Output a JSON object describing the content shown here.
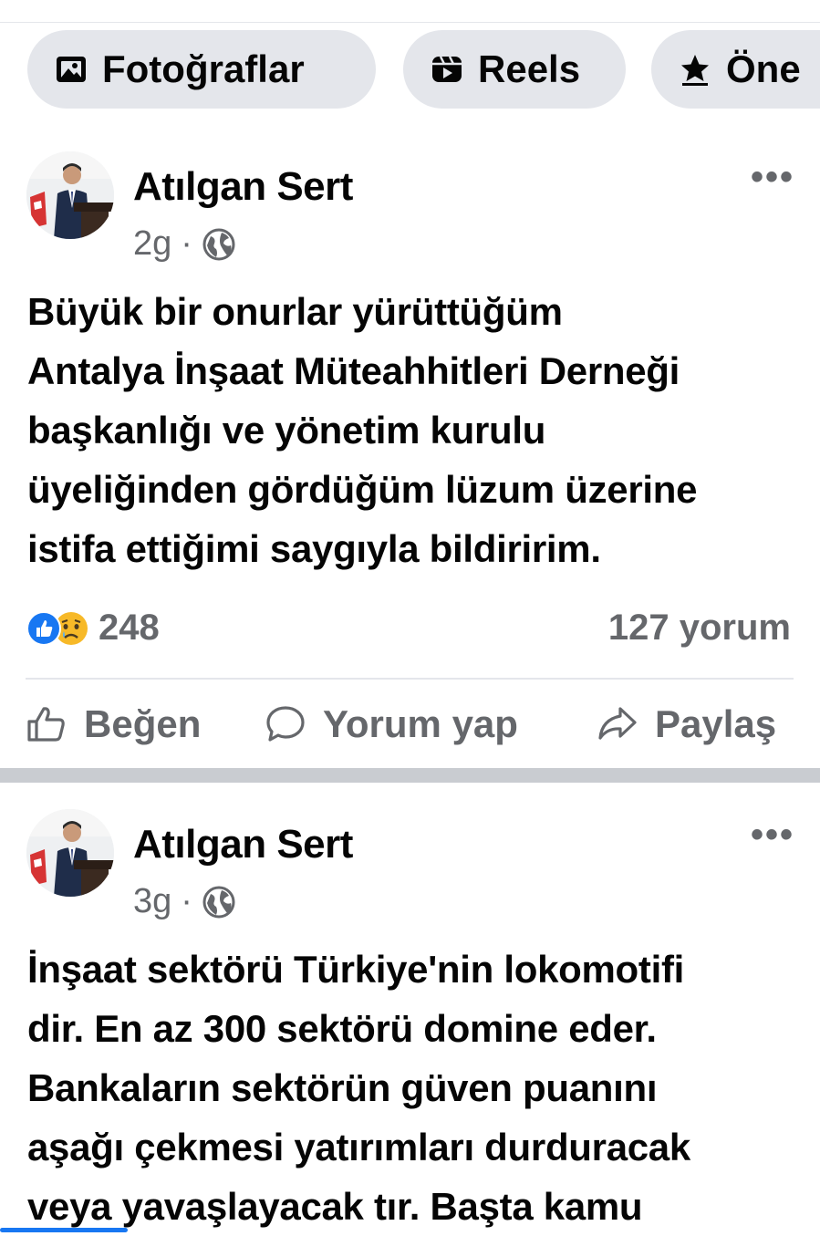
{
  "tabs": {
    "photos": "Fotoğraflar",
    "reels": "Reels",
    "featured": "Öne"
  },
  "posts": [
    {
      "author": "Atılgan Sert",
      "time": "2g",
      "dot": "·",
      "more": "•••",
      "lines": [
        "Büyük bir onurlar yürüttüğüm",
        "Antalya İnşaat Müteahhitleri Derneği",
        "başkanlığı ve yönetim kurulu",
        "üyeliğinden gördüğüm lüzum üzerine",
        "istifa ettiğimi saygıyla  bildiririm."
      ],
      "reaction_count": "248",
      "comment_count": "127 yorum",
      "actions": {
        "like": "Beğen",
        "comment": "Yorum yap",
        "share": "Paylaş"
      }
    },
    {
      "author": "Atılgan Sert",
      "time": "3g",
      "dot": "·",
      "more": "•••",
      "lines": [
        "İnşaat sektörü Türkiye'nin lokomotifi",
        "dir. En az 300 sektörü domine eder.",
        "Bankaların sektörün güven puanını",
        "aşağı çekmesi yatırımları durduracak",
        "veya yavaşlayacak tır. Başta kamu"
      ]
    }
  ],
  "colors": {
    "secondary_text": "#65676b",
    "chip_bg": "#e4e6eb",
    "like_blue": "#1877f2",
    "sad_yellow": "#f7b928"
  }
}
